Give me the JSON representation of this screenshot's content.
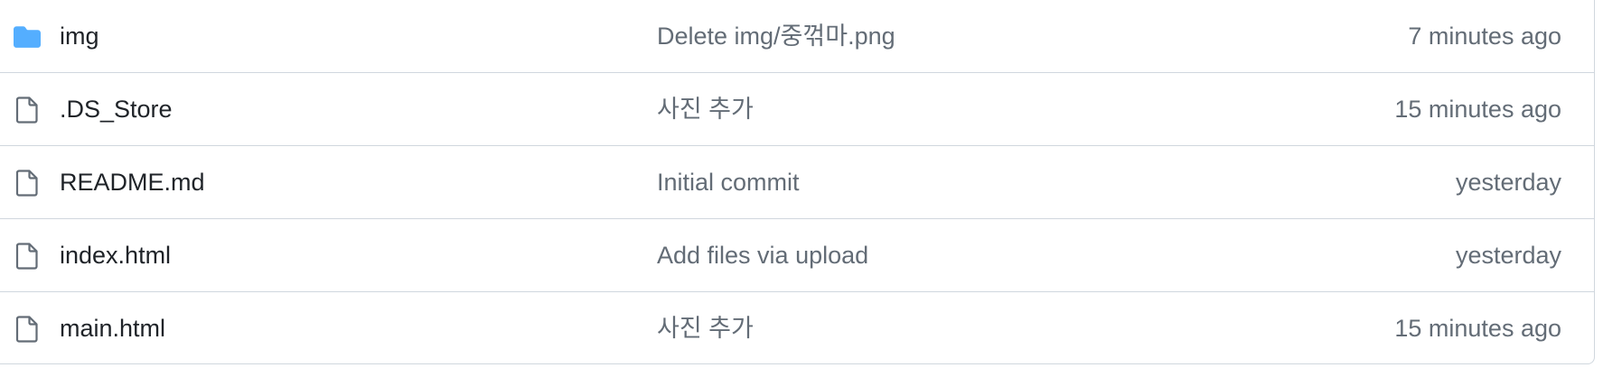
{
  "files": [
    {
      "name": "img",
      "type": "directory",
      "icon": "folder-icon",
      "message": "Delete img/중꺾마.png",
      "age": "7 minutes ago"
    },
    {
      "name": ".DS_Store",
      "type": "file",
      "icon": "file-icon",
      "message": "사진 추가",
      "age": "15 minutes ago"
    },
    {
      "name": "README.md",
      "type": "file",
      "icon": "file-icon",
      "message": "Initial commit",
      "age": "yesterday"
    },
    {
      "name": "index.html",
      "type": "file",
      "icon": "file-icon",
      "message": "Add files via upload",
      "age": "yesterday"
    },
    {
      "name": "main.html",
      "type": "file",
      "icon": "file-icon",
      "message": "사진 추가",
      "age": "15 minutes ago"
    }
  ],
  "colors": {
    "folder": "#54aeff",
    "file_icon": "#636c76",
    "text_primary": "#1f2328",
    "text_muted": "#636c76",
    "border": "#d0d7de"
  }
}
